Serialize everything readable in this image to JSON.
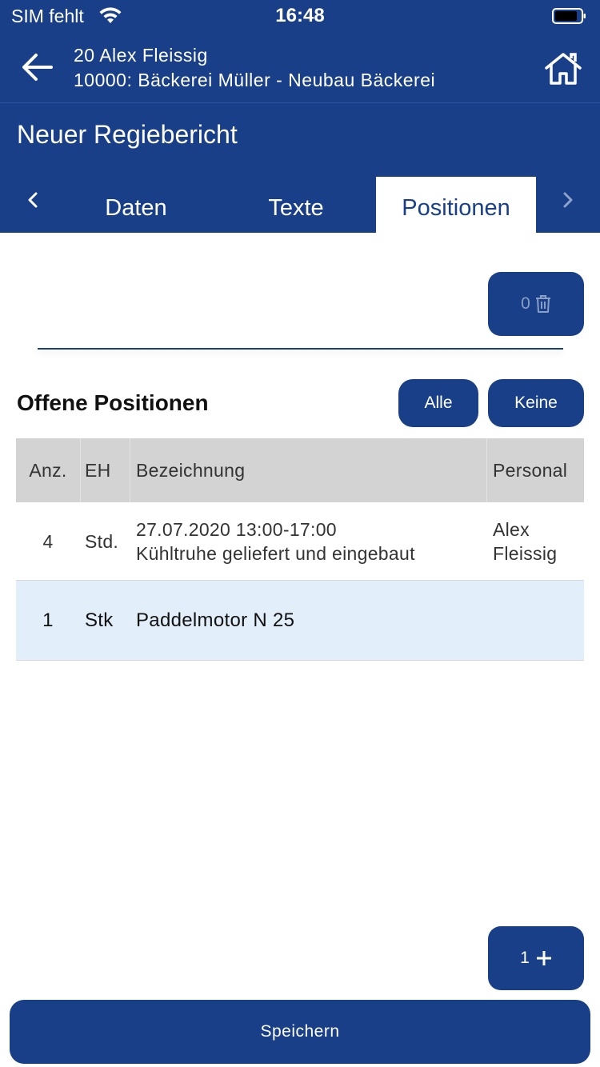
{
  "status_bar": {
    "carrier": "SIM fehlt",
    "time": "16:48"
  },
  "nav": {
    "line1": "20 Alex Fleissig",
    "line2": "10000: Bäckerei Müller - Neubau Bäckerei",
    "back_icon": "arrow-left-icon",
    "home_icon": "home-icon"
  },
  "page": {
    "title": "Neuer Regiebericht"
  },
  "tabs": [
    {
      "label": "Daten",
      "active": false
    },
    {
      "label": "Texte",
      "active": false
    },
    {
      "label": "Positionen",
      "active": true
    }
  ],
  "tab_nav": {
    "prev_icon": "chevron-left-icon",
    "next_icon": "chevron-right-icon"
  },
  "delete_button": {
    "count": "0",
    "icon": "trash-icon"
  },
  "section": {
    "title": "Offene Positionen",
    "all_label": "Alle",
    "none_label": "Keine"
  },
  "table": {
    "columns": [
      "Anz.",
      "EH",
      "Bezeichnung",
      "Personal"
    ],
    "rows": [
      {
        "qty": "4",
        "unit": "Std.",
        "desc_line1": "27.07.2020 13:00-17:00",
        "desc_line2": "Kühltruhe geliefert und eingebaut",
        "personal_line1": "Alex",
        "personal_line2": "Fleissig",
        "selected": false
      },
      {
        "qty": "1",
        "unit": "Stk",
        "desc_line1": "Paddelmotor N 25",
        "desc_line2": "",
        "personal_line1": "",
        "personal_line2": "",
        "selected": true
      }
    ]
  },
  "add_button": {
    "count": "1",
    "icon": "plus-icon"
  },
  "save_button": {
    "label": "Speichern"
  },
  "colors": {
    "primary": "#193f88",
    "selected_row": "#e2eef9",
    "table_header": "#d3d3d3"
  }
}
